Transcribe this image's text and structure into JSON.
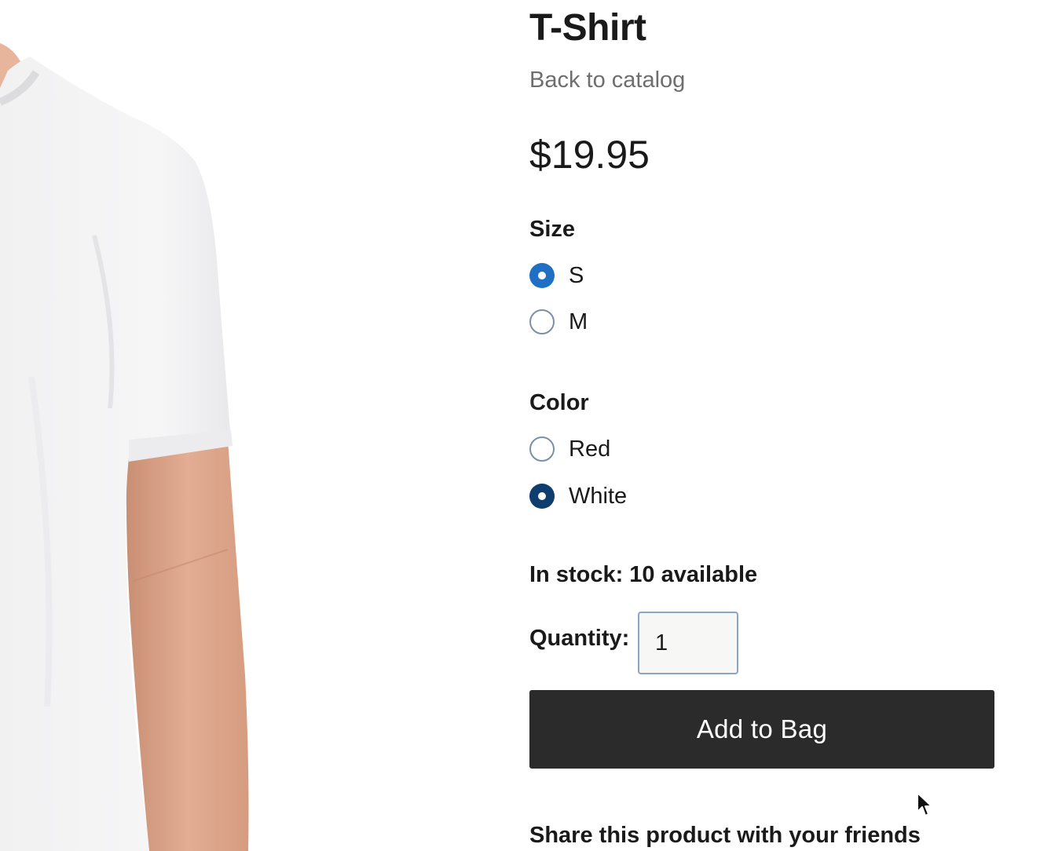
{
  "product": {
    "title": "T-Shirt",
    "back_link": "Back to catalog",
    "price": "$19.95",
    "image_alt": "White T-Shirt"
  },
  "size": {
    "label": "Size",
    "options": [
      {
        "label": "S",
        "checked": true
      },
      {
        "label": "M",
        "checked": false
      }
    ]
  },
  "color": {
    "label": "Color",
    "options": [
      {
        "label": "Red",
        "checked": false
      },
      {
        "label": "White",
        "checked": true
      }
    ]
  },
  "stock": {
    "text": "In stock: 10 available"
  },
  "quantity": {
    "label": "Quantity:",
    "value": "1"
  },
  "add_button": {
    "label": "Add to Bag"
  },
  "share": {
    "heading": "Share this product with your friends"
  },
  "colors": {
    "size_selected": "#1f6fc5",
    "color_selected": "#0f3d6e",
    "button_bg": "#2b2b2b",
    "radio_border": "#7b8fa6",
    "link": "#6e6e6e"
  },
  "icons": {
    "cursor": "mouse-pointer-icon"
  }
}
